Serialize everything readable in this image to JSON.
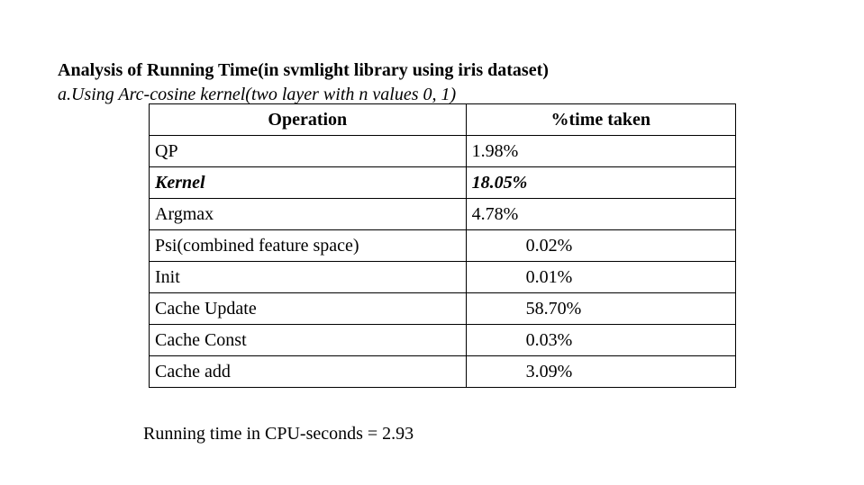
{
  "heading": {
    "title": "Analysis of Running Time(in svmlight library using iris dataset)",
    "subtitle": "a.Using Arc-cosine kernel(two layer with n values 0, 1)"
  },
  "table": {
    "headers": [
      "Operation",
      "%time taken"
    ],
    "rows": [
      {
        "operation": "QP",
        "time": "1.98%"
      },
      {
        "operation": "Kernel",
        "time": "18.05%",
        "emphasized": true
      },
      {
        "operation": "Argmax",
        "time": "4.78%"
      },
      {
        "operation": "Psi(combined feature space)",
        "time": "0.02%"
      },
      {
        "operation": "Init",
        "time": "0.01%"
      },
      {
        "operation": "Cache Update",
        "time": "58.70%"
      },
      {
        "operation": "Cache Const",
        "time": "0.03%"
      },
      {
        "operation": "Cache add",
        "time": "3.09%"
      }
    ]
  },
  "footer": {
    "text": "Running time in CPU-seconds = 2.93"
  }
}
